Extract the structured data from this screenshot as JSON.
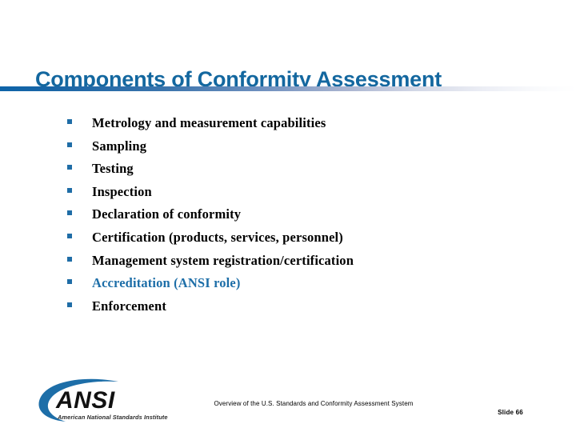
{
  "slide": {
    "title": "Components of Conformity Assessment",
    "bullets": [
      {
        "text": "Metrology and measurement capabilities",
        "highlight": false
      },
      {
        "text": "Sampling",
        "highlight": false
      },
      {
        "text": "Testing",
        "highlight": false
      },
      {
        "text": "Inspection",
        "highlight": false
      },
      {
        "text": "Declaration of conformity",
        "highlight": false
      },
      {
        "text": "Certification (products, services, personnel)",
        "highlight": false
      },
      {
        "text": "Management system registration/certification",
        "highlight": false
      },
      {
        "text": "Accreditation (ANSI role)",
        "highlight": true
      },
      {
        "text": "Enforcement",
        "highlight": false
      }
    ],
    "logo": {
      "wordmark": "ANSI",
      "tagline": "American National Standards Institute"
    },
    "footer": {
      "note": "Overview of the U.S. Standards and Conformity Assessment System",
      "slide_number": "Slide 66"
    },
    "colors": {
      "title_blue": "#13679f",
      "bullet_blue": "#1f6da6",
      "highlight_blue": "#1d6ea8",
      "rule_blue": "#0e64a8",
      "logo_blue": "#1d6ea8",
      "background": "#ffffff",
      "text_black": "#000000"
    }
  }
}
